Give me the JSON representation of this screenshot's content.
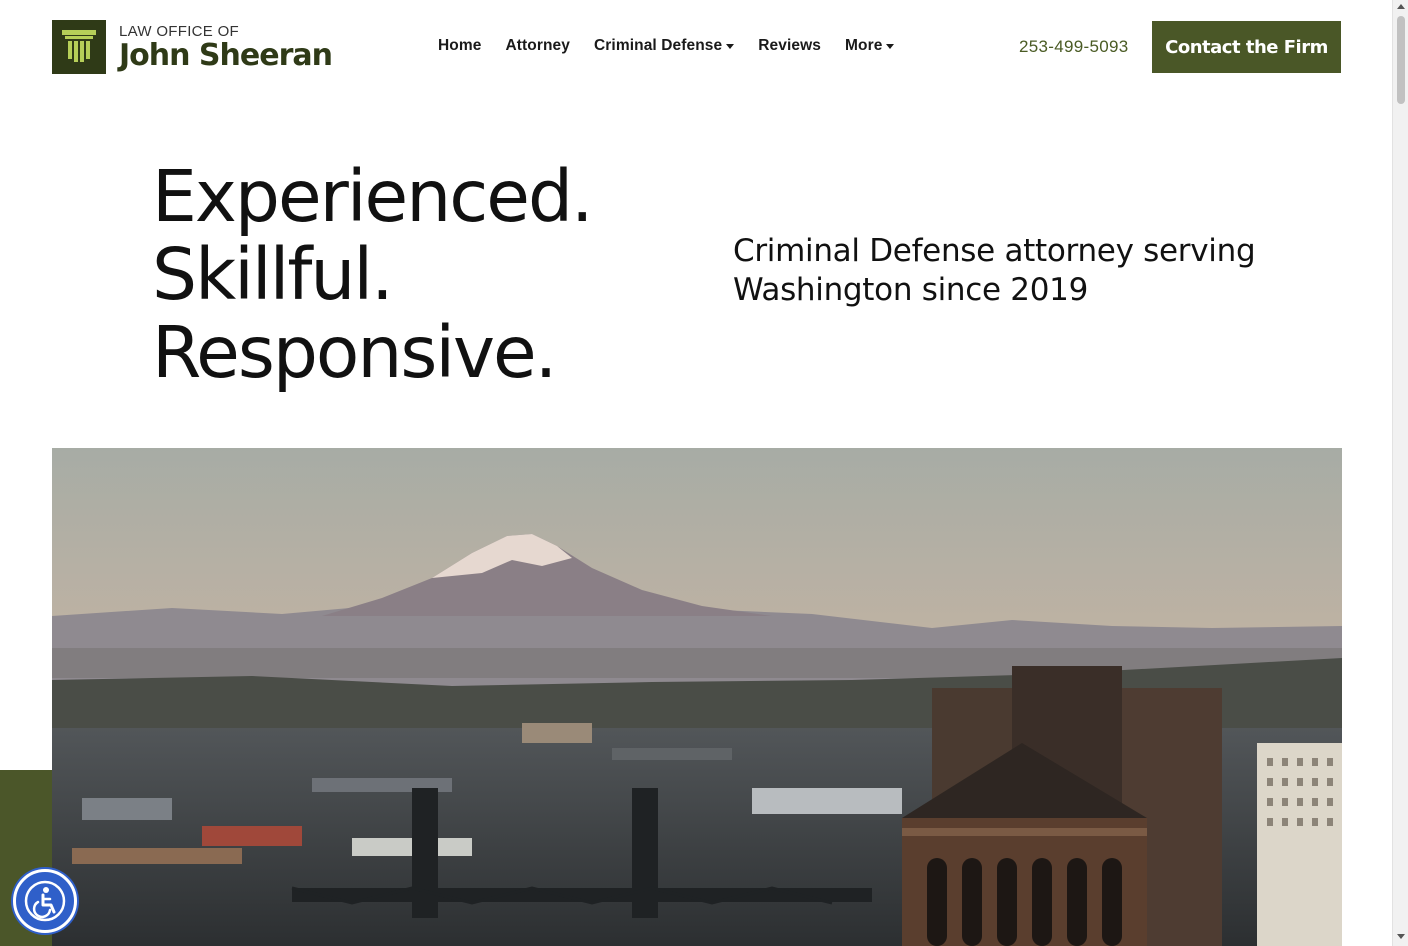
{
  "header": {
    "logo": {
      "pre_title": "LAW OFFICE OF",
      "name": "John Sheeran",
      "icon": "pillar-icon"
    },
    "nav": [
      {
        "label": "Home",
        "has_dropdown": false
      },
      {
        "label": "Attorney",
        "has_dropdown": false
      },
      {
        "label": "Criminal Defense",
        "has_dropdown": true
      },
      {
        "label": "Reviews",
        "has_dropdown": false
      },
      {
        "label": "More",
        "has_dropdown": true
      }
    ],
    "phone": "253-499-5093",
    "cta_label": "Contact the Firm"
  },
  "hero": {
    "headline": [
      "Experienced.",
      "Skillful.",
      "Responsive."
    ],
    "subheadline": "Criminal Defense attorney serving Washington since 2019",
    "image_icon": "city-mountain-photo"
  },
  "accessibility_button": {
    "icon": "accessibility-icon"
  },
  "colors": {
    "brand_dark": "#2f3a17",
    "brand": "#4a5727",
    "accessibility_blue": "#2f5fc9"
  }
}
